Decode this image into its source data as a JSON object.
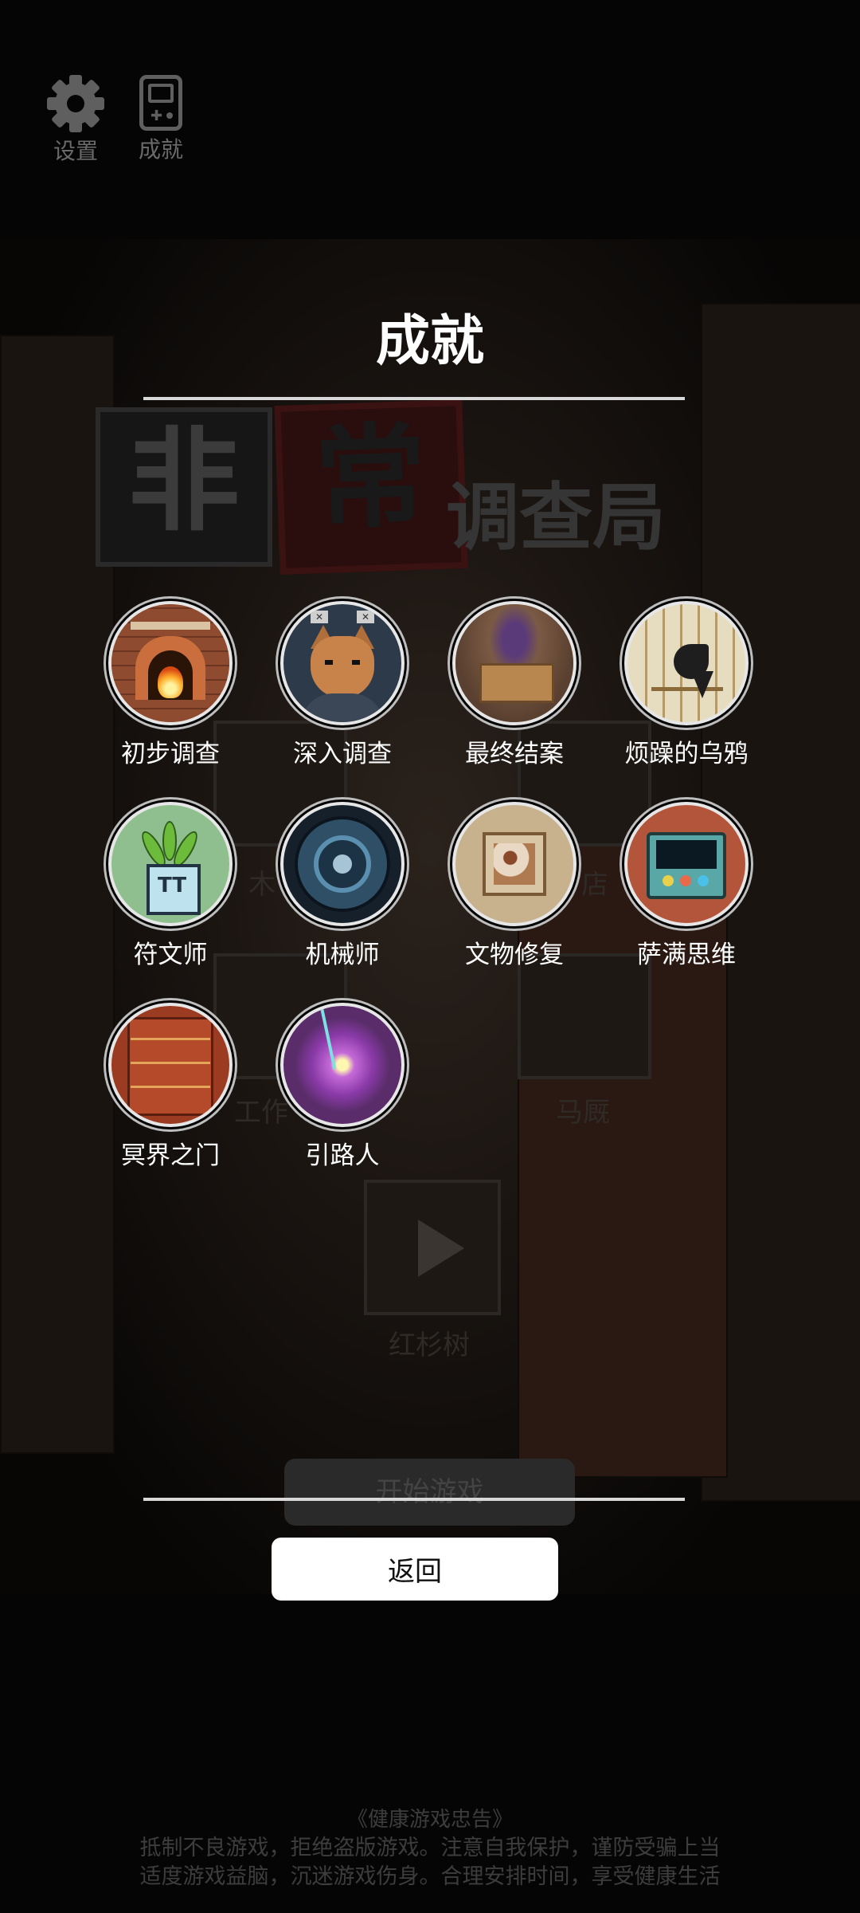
{
  "top_bar": {
    "settings_label": "设置",
    "achievements_label": "成就"
  },
  "background": {
    "logo_chars": [
      "非",
      "常",
      "调查局"
    ],
    "labels": [
      "木",
      "店",
      "工作",
      "马厩",
      "红杉树"
    ],
    "start_button": "开始游戏"
  },
  "panel": {
    "title": "成就",
    "achievements": [
      {
        "name": "初步调查",
        "icon": "fireplace-icon"
      },
      {
        "name": "深入调查",
        "icon": "fox-icon"
      },
      {
        "name": "最终结案",
        "icon": "chest-icon"
      },
      {
        "name": "烦躁的乌鸦",
        "icon": "crow-icon"
      },
      {
        "name": "符文师",
        "icon": "plant-pot-icon"
      },
      {
        "name": "机械师",
        "icon": "wheel-icon"
      },
      {
        "name": "文物修复",
        "icon": "painting-icon"
      },
      {
        "name": "萨满思维",
        "icon": "radio-device-icon"
      },
      {
        "name": "冥界之门",
        "icon": "door-icon"
      },
      {
        "name": "引路人",
        "icon": "portal-icon"
      }
    ],
    "back_button": "返回"
  },
  "footer": {
    "title": "《健康游戏忠告》",
    "line1": "抵制不良游戏，拒绝盗版游戏。注意自我保护，谨防受骗上当",
    "line2": "适度游戏益脑，沉迷游戏伤身。合理安排时间，享受健康生活"
  }
}
